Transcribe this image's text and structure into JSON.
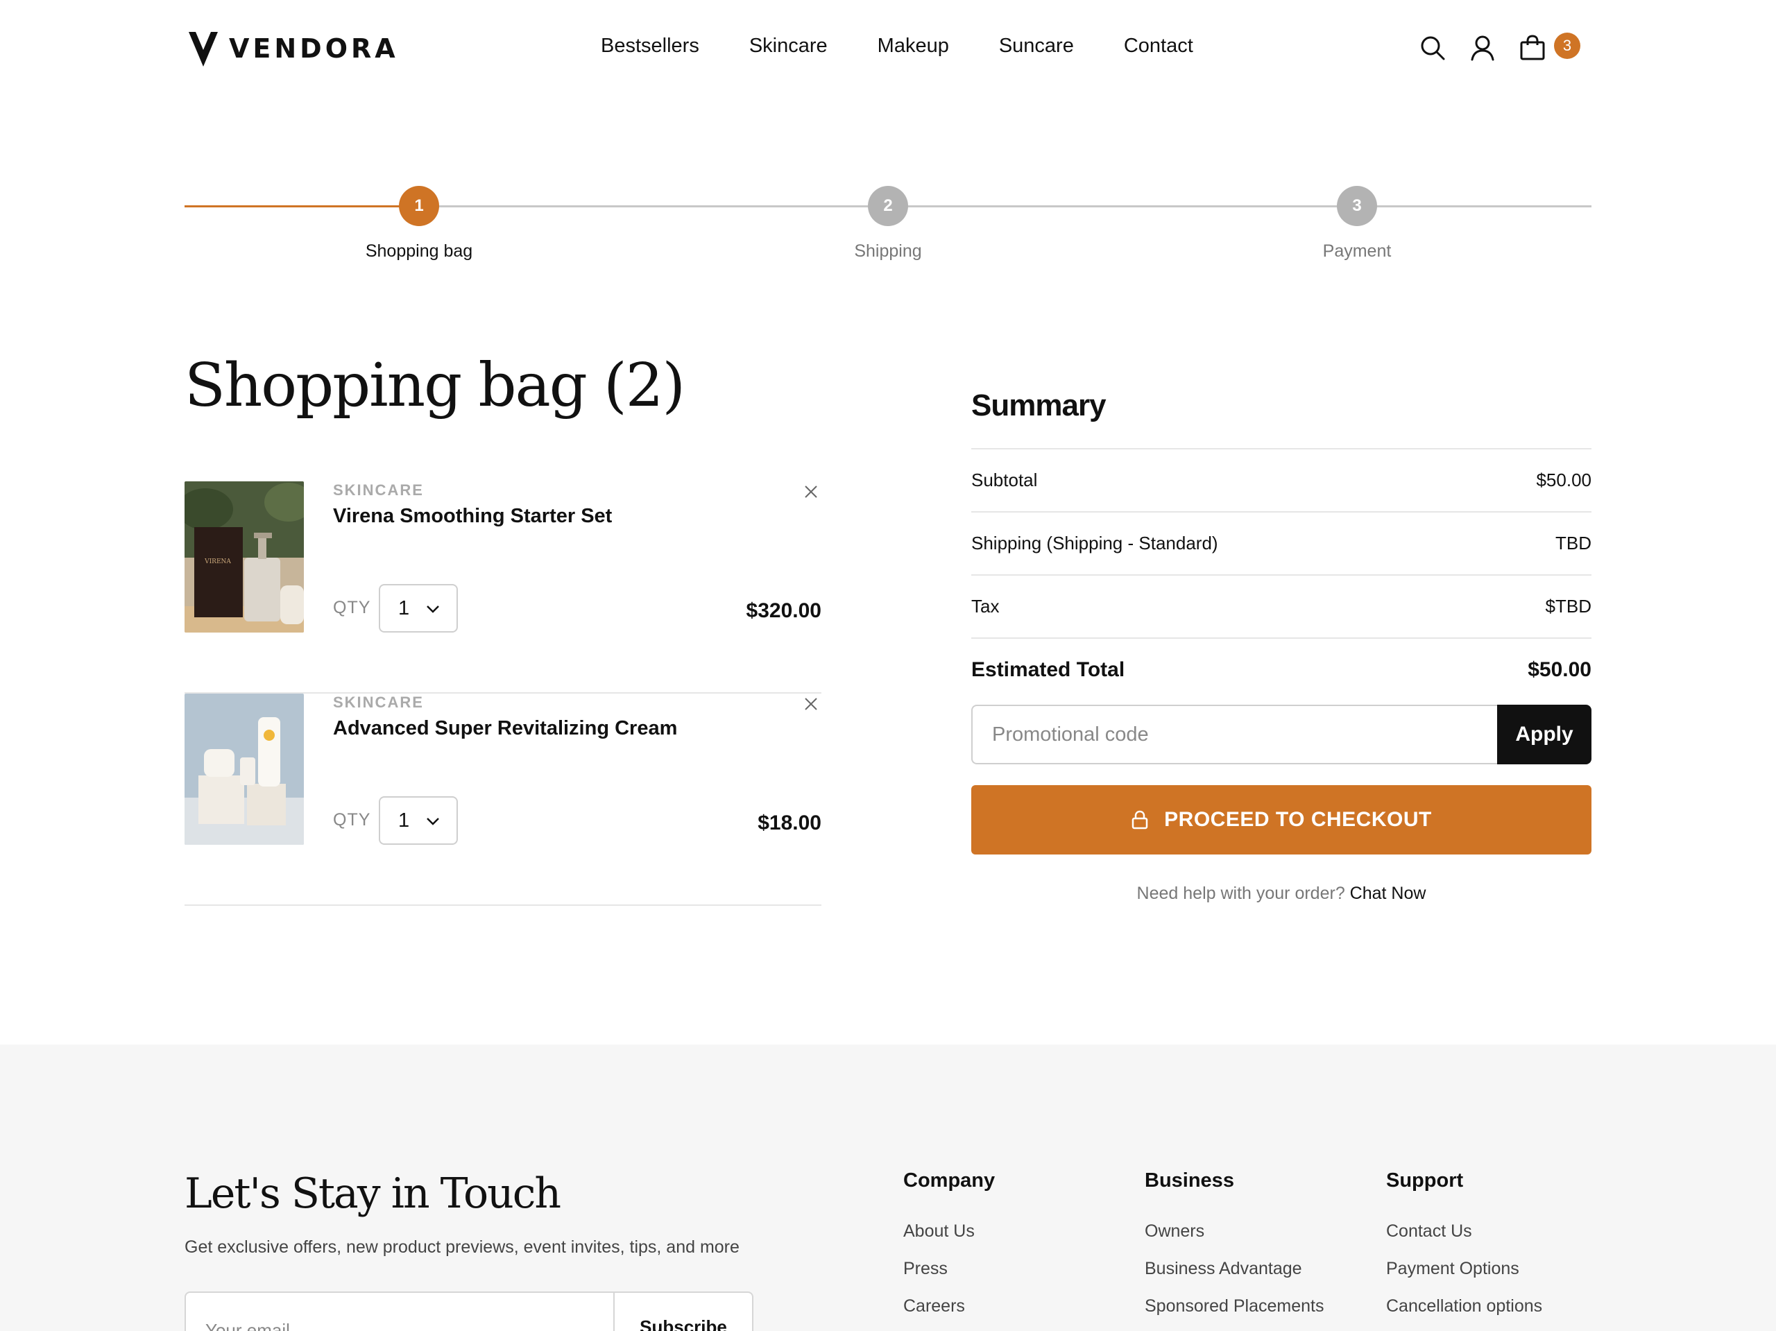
{
  "brand": {
    "name": "VENDORA",
    "accent": "#cf7425"
  },
  "nav": {
    "items": [
      "Bestsellers",
      "Skincare",
      "Makeup",
      "Suncare",
      "Contact"
    ]
  },
  "header": {
    "cart_count": "3"
  },
  "steps": [
    {
      "number": "1",
      "label": "Shopping bag",
      "state": "active"
    },
    {
      "number": "2",
      "label": "Shipping",
      "state": "inactive"
    },
    {
      "number": "3",
      "label": "Payment",
      "state": "inactive"
    }
  ],
  "bag": {
    "title": "Shopping bag (2)",
    "qty_label": "QTY",
    "items": [
      {
        "category": "SKINCARE",
        "name": "Virena Smoothing Starter Set",
        "qty": "1",
        "price": "$320.00",
        "image_label": "VIRENA"
      },
      {
        "category": "SKINCARE",
        "name": "Advanced Super Revitalizing Cream",
        "qty": "1",
        "price": "$18.00"
      }
    ]
  },
  "summary": {
    "title": "Summary",
    "rows": [
      {
        "label": "Subtotal",
        "value": "$50.00"
      },
      {
        "label": "Shipping (Shipping - Standard)",
        "value": "TBD"
      },
      {
        "label": "Tax",
        "value": "$TBD"
      }
    ],
    "total": {
      "label": "Estimated Total",
      "value": "$50.00"
    },
    "promo_placeholder": "Promotional code",
    "apply_label": "Apply",
    "checkout_label": "PROCEED TO CHECKOUT",
    "help_text": "Need help with your order?",
    "help_link": "Chat Now"
  },
  "footer": {
    "title": "Let's Stay in Touch",
    "subtitle": "Get exclusive offers, new product previews, event invites, tips, and more",
    "email_placeholder": "Your email",
    "subscribe_label": "Subscribe",
    "columns": [
      {
        "title": "Company",
        "links": [
          "About Us",
          "Press",
          "Careers"
        ]
      },
      {
        "title": "Business",
        "links": [
          "Owners",
          "Business Advantage",
          "Sponsored Placements"
        ]
      },
      {
        "title": "Support",
        "links": [
          "Contact Us",
          "Payment Options",
          "Cancellation options"
        ]
      }
    ]
  }
}
